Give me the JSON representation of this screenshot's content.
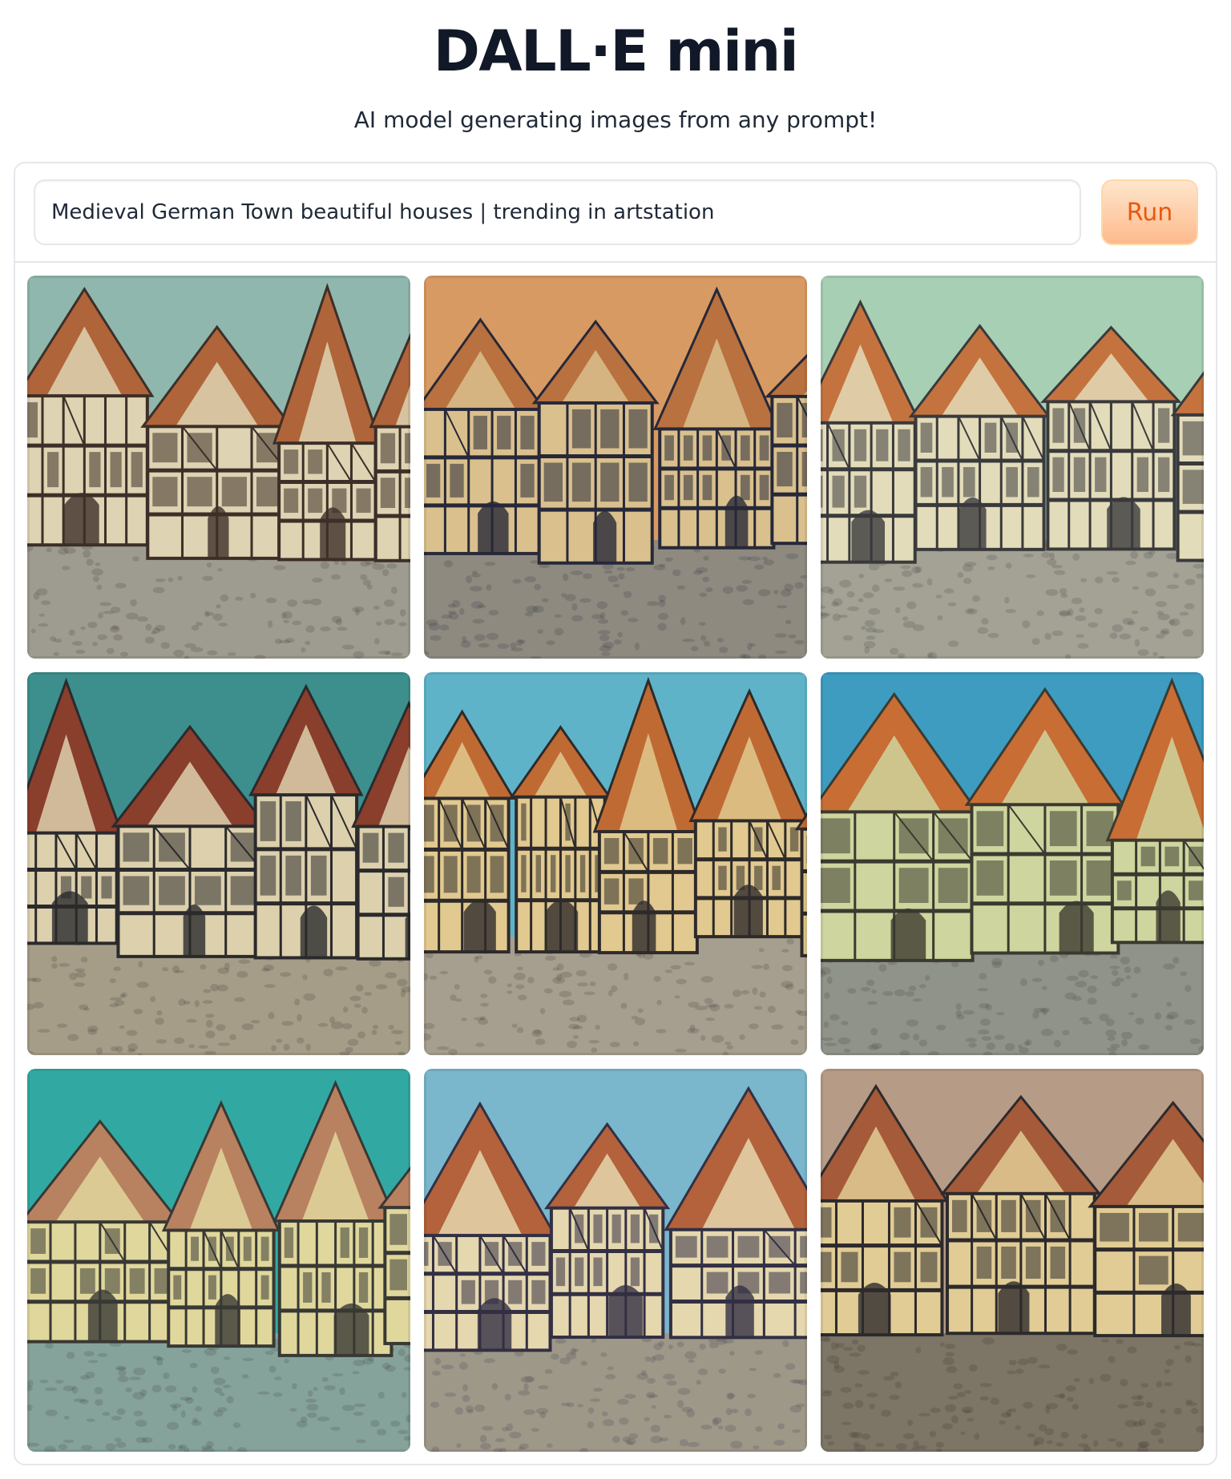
{
  "app": {
    "title": "DALL·E mini",
    "subtitle": "AI model generating images from any prompt!"
  },
  "prompt": {
    "value": "Medieval German Town beautiful houses | trending in artstation",
    "run_label": "Run"
  },
  "gallery": {
    "images": [
      {
        "sky": "#8fb7ad",
        "roof": "#b0643a",
        "plaster": "#ded3b2",
        "timber": "#3d2f28",
        "ground": "#9e9c90"
      },
      {
        "sky": "#d89a63",
        "roof": "#b9713f",
        "plaster": "#d9c08d",
        "timber": "#272838",
        "ground": "#8e8a80"
      },
      {
        "sky": "#a7cfb4",
        "roof": "#c5733e",
        "plaster": "#e3dcba",
        "timber": "#3a3a3c",
        "ground": "#a3a294"
      },
      {
        "sky": "#3c8f8c",
        "roof": "#8a3e2c",
        "plaster": "#dcd0ad",
        "timber": "#2b2a2c",
        "ground": "#a59d88"
      },
      {
        "sky": "#5fb3c8",
        "roof": "#c06a33",
        "plaster": "#e1c98f",
        "timber": "#2e2a2a",
        "ground": "#a69f8f"
      },
      {
        "sky": "#3d9cc0",
        "roof": "#c86d34",
        "plaster": "#cfd59e",
        "timber": "#3b3a30",
        "ground": "#8f9389"
      },
      {
        "sky": "#31a9a2",
        "roof": "#b88160",
        "plaster": "#e0d79c",
        "timber": "#383834",
        "ground": "#86a39b"
      },
      {
        "sky": "#7ab6cc",
        "roof": "#b3623b",
        "plaster": "#e5d7ae",
        "timber": "#333044",
        "ground": "#9e9889"
      },
      {
        "sky": "#b69b86",
        "roof": "#a55a39",
        "plaster": "#e0cc94",
        "timber": "#2d2a2c",
        "ground": "#7d7565"
      }
    ]
  }
}
